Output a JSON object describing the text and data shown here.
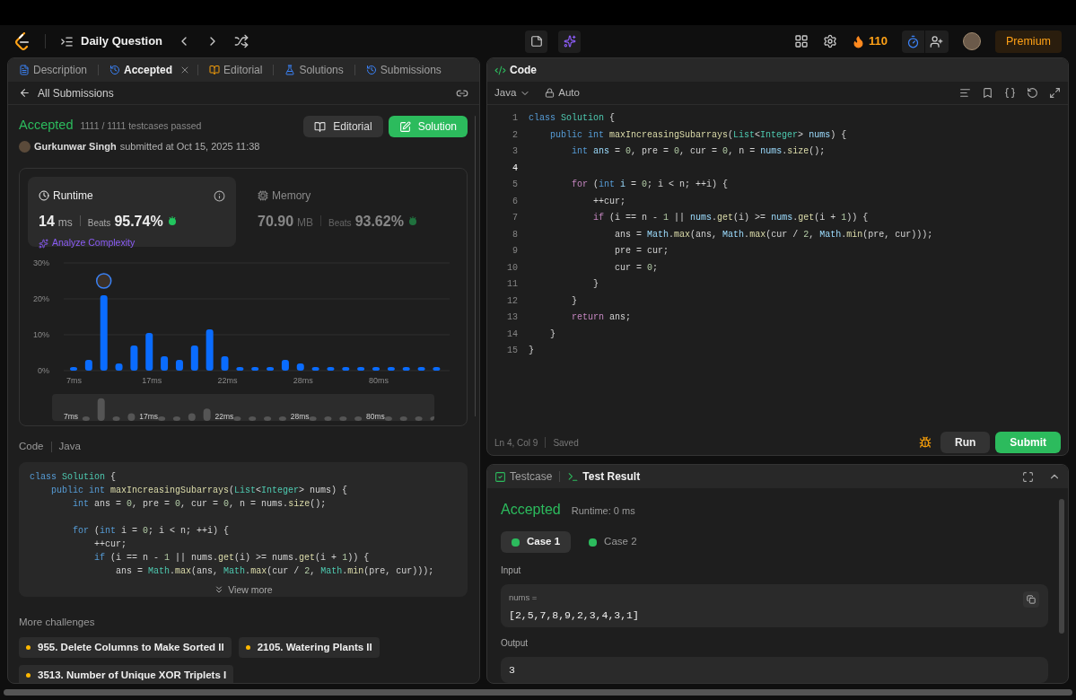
{
  "topbar": {
    "title": "Daily Question",
    "streak": "110",
    "premium": "Premium"
  },
  "left_panel": {
    "tabs": [
      {
        "label": "Description",
        "selected": false,
        "kind": "description"
      },
      {
        "label": "Accepted",
        "selected": true,
        "kind": "accepted",
        "closable": true
      },
      {
        "label": "Editorial",
        "selected": false,
        "kind": "editorial"
      },
      {
        "label": "Solutions",
        "selected": false,
        "kind": "solutions"
      },
      {
        "label": "Submissions",
        "selected": false,
        "kind": "submissions"
      }
    ],
    "back_link": "All Submissions",
    "status": "Accepted",
    "testcases": "1111 / 1111 testcases passed",
    "author": "Gurkunwar Singh",
    "submitted": "submitted at Oct 15, 2025 11:38",
    "buttons": [
      {
        "label": "Editorial",
        "kind": "secondary"
      },
      {
        "label": "Solution",
        "kind": "primary"
      }
    ],
    "runtime": {
      "label": "Runtime",
      "value": "14",
      "unit": "ms",
      "beats_label": "Beats",
      "beats": "95.74%",
      "analyze": "Analyze Complexity",
      "selected": true
    },
    "memory": {
      "label": "Memory",
      "value": "70.90",
      "unit": "MB",
      "beats_label": "Beats",
      "beats": "93.62%",
      "selected": false
    },
    "chart_data": {
      "type": "bar",
      "categories": [
        "7ms",
        null,
        null,
        null,
        null,
        "17ms",
        null,
        null,
        null,
        null,
        "22ms",
        null,
        null,
        null,
        null,
        "28ms",
        null,
        null,
        null,
        null,
        "80ms",
        null,
        null,
        null,
        null
      ],
      "values": [
        1,
        3,
        21,
        2,
        7,
        10.5,
        4,
        3,
        7,
        11.5,
        4,
        1,
        1,
        1,
        3,
        2,
        1,
        1,
        1,
        1,
        1,
        1,
        1,
        1,
        1
      ],
      "ylim": [
        0,
        30
      ],
      "yticks": [
        {
          "value": 0,
          "label": "0%"
        },
        {
          "value": 10,
          "label": "10%"
        },
        {
          "value": 20,
          "label": "20%"
        },
        {
          "value": 30,
          "label": "30%"
        }
      ]
    },
    "overview_labels": [
      "7ms",
      "17ms",
      "22ms",
      "28ms",
      "80ms"
    ],
    "code_label": "Code",
    "code_lang": "Java",
    "code_lines": [
      {
        "kind": "code",
        "tokens": [
          {
            "kind": "keyword",
            "text": "class "
          },
          {
            "kind": "type",
            "text": "Solution"
          },
          {
            "kind": "plain",
            "text": " {"
          }
        ]
      },
      {
        "kind": "code",
        "tokens": [
          {
            "kind": "keyword",
            "text": "    public int "
          },
          {
            "kind": "function",
            "text": "maxIncreasingSubarrays"
          },
          {
            "kind": "plain",
            "text": "("
          },
          {
            "kind": "type",
            "text": "List"
          },
          {
            "kind": "plain",
            "text": "<"
          },
          {
            "kind": "type",
            "text": "Integer"
          },
          {
            "kind": "plain",
            "text": "> nums) {"
          }
        ]
      },
      {
        "kind": "code",
        "tokens": [
          {
            "kind": "keyword",
            "text": "        int"
          },
          {
            "kind": "plain",
            "text": " ans = "
          },
          {
            "kind": "number",
            "text": "0"
          },
          {
            "kind": "plain",
            "text": ", pre = "
          },
          {
            "kind": "number",
            "text": "0"
          },
          {
            "kind": "plain",
            "text": ", cur = "
          },
          {
            "kind": "number",
            "text": "0"
          },
          {
            "kind": "plain",
            "text": ", n = nums."
          },
          {
            "kind": "function",
            "text": "size"
          },
          {
            "kind": "plain",
            "text": "();"
          }
        ]
      },
      {
        "kind": "blank"
      },
      {
        "kind": "code",
        "tokens": [
          {
            "kind": "keyword",
            "text": "        for"
          },
          {
            "kind": "plain",
            "text": " ("
          },
          {
            "kind": "keyword",
            "text": "int"
          },
          {
            "kind": "plain",
            "text": " i = "
          },
          {
            "kind": "number",
            "text": "0"
          },
          {
            "kind": "plain",
            "text": "; i < n; ++i) {"
          }
        ]
      },
      {
        "kind": "code",
        "tokens": [
          {
            "kind": "plain",
            "text": "            ++cur;"
          }
        ]
      },
      {
        "kind": "code",
        "tokens": [
          {
            "kind": "keyword",
            "text": "            if"
          },
          {
            "kind": "plain",
            "text": " (i == n - "
          },
          {
            "kind": "number",
            "text": "1"
          },
          {
            "kind": "plain",
            "text": " || nums."
          },
          {
            "kind": "function",
            "text": "get"
          },
          {
            "kind": "plain",
            "text": "(i) >= nums."
          },
          {
            "kind": "function",
            "text": "get"
          },
          {
            "kind": "plain",
            "text": "(i + "
          },
          {
            "kind": "number",
            "text": "1"
          },
          {
            "kind": "plain",
            "text": ")) {"
          }
        ]
      },
      {
        "kind": "code",
        "tokens": [
          {
            "kind": "plain",
            "text": "                ans = "
          },
          {
            "kind": "type",
            "text": "Math"
          },
          {
            "kind": "plain",
            "text": "."
          },
          {
            "kind": "function",
            "text": "max"
          },
          {
            "kind": "plain",
            "text": "(ans, "
          },
          {
            "kind": "type",
            "text": "Math"
          },
          {
            "kind": "plain",
            "text": "."
          },
          {
            "kind": "function",
            "text": "max"
          },
          {
            "kind": "plain",
            "text": "(cur / "
          },
          {
            "kind": "number",
            "text": "2"
          },
          {
            "kind": "plain",
            "text": ", "
          },
          {
            "kind": "type",
            "text": "Math"
          },
          {
            "kind": "plain",
            "text": "."
          },
          {
            "kind": "function",
            "text": "min"
          },
          {
            "kind": "plain",
            "text": "(pre, cur)));"
          }
        ]
      }
    ],
    "view_more": "View more",
    "more_title": "More challenges",
    "challenges": [
      {
        "label": "955. Delete Columns to Make Sorted II",
        "color": "#ffb800"
      },
      {
        "label": "2105. Watering Plants II",
        "color": "#ffb800"
      },
      {
        "label": "3513. Number of Unique XOR Triplets I",
        "color": "#ffb800"
      }
    ]
  },
  "editor": {
    "tab": "Code",
    "language": "Java",
    "mode": "Auto",
    "lines": [
      {
        "number": "1",
        "selected": false,
        "tokens": [
          {
            "kind": "keyword",
            "text": "class "
          },
          {
            "kind": "type",
            "text": "Solution"
          },
          {
            "kind": "plain",
            "text": " {"
          }
        ]
      },
      {
        "number": "2",
        "selected": false,
        "tokens": [
          {
            "kind": "keyword",
            "text": "    public int "
          },
          {
            "kind": "function",
            "text": "maxIncreasingSubarrays"
          },
          {
            "kind": "plain",
            "text": "("
          },
          {
            "kind": "type",
            "text": "List"
          },
          {
            "kind": "plain",
            "text": "<"
          },
          {
            "kind": "type",
            "text": "Integer"
          },
          {
            "kind": "plain",
            "text": "> "
          },
          {
            "kind": "variable",
            "text": "nums"
          },
          {
            "kind": "plain",
            "text": ") {"
          }
        ]
      },
      {
        "number": "3",
        "selected": false,
        "tokens": [
          {
            "kind": "keyword",
            "text": "        int "
          },
          {
            "kind": "variable",
            "text": "ans"
          },
          {
            "kind": "plain",
            "text": " = "
          },
          {
            "kind": "number",
            "text": "0"
          },
          {
            "kind": "plain",
            "text": ", pre = "
          },
          {
            "kind": "number",
            "text": "0"
          },
          {
            "kind": "plain",
            "text": ", cur = "
          },
          {
            "kind": "number",
            "text": "0"
          },
          {
            "kind": "plain",
            "text": ", n = "
          },
          {
            "kind": "variable",
            "text": "nums"
          },
          {
            "kind": "plain",
            "text": "."
          },
          {
            "kind": "function",
            "text": "size"
          },
          {
            "kind": "plain",
            "text": "();"
          }
        ]
      },
      {
        "number": "4",
        "selected": true
      },
      {
        "number": "5",
        "selected": false,
        "tokens": [
          {
            "kind": "control",
            "text": "        for"
          },
          {
            "kind": "plain",
            "text": " ("
          },
          {
            "kind": "keyword",
            "text": "int "
          },
          {
            "kind": "variable",
            "text": "i"
          },
          {
            "kind": "plain",
            "text": " = "
          },
          {
            "kind": "number",
            "text": "0"
          },
          {
            "kind": "plain",
            "text": "; i < n; ++i) {"
          }
        ]
      },
      {
        "number": "6",
        "selected": false,
        "tokens": [
          {
            "kind": "plain",
            "text": "            ++cur;"
          }
        ]
      },
      {
        "number": "7",
        "selected": false,
        "tokens": [
          {
            "kind": "control",
            "text": "            if"
          },
          {
            "kind": "plain",
            "text": " (i == n - "
          },
          {
            "kind": "number",
            "text": "1"
          },
          {
            "kind": "plain",
            "text": " || "
          },
          {
            "kind": "variable",
            "text": "nums"
          },
          {
            "kind": "plain",
            "text": "."
          },
          {
            "kind": "function",
            "text": "get"
          },
          {
            "kind": "plain",
            "text": "(i) >= "
          },
          {
            "kind": "variable",
            "text": "nums"
          },
          {
            "kind": "plain",
            "text": "."
          },
          {
            "kind": "function",
            "text": "get"
          },
          {
            "kind": "plain",
            "text": "(i + "
          },
          {
            "kind": "number",
            "text": "1"
          },
          {
            "kind": "plain",
            "text": ")) {"
          }
        ]
      },
      {
        "number": "8",
        "selected": false,
        "tokens": [
          {
            "kind": "plain",
            "text": "                ans = "
          },
          {
            "kind": "variable",
            "text": "Math"
          },
          {
            "kind": "plain",
            "text": "."
          },
          {
            "kind": "function",
            "text": "max"
          },
          {
            "kind": "plain",
            "text": "(ans, "
          },
          {
            "kind": "variable",
            "text": "Math"
          },
          {
            "kind": "plain",
            "text": "."
          },
          {
            "kind": "function",
            "text": "max"
          },
          {
            "kind": "plain",
            "text": "(cur / "
          },
          {
            "kind": "number",
            "text": "2"
          },
          {
            "kind": "plain",
            "text": ", "
          },
          {
            "kind": "variable",
            "text": "Math"
          },
          {
            "kind": "plain",
            "text": "."
          },
          {
            "kind": "function",
            "text": "min"
          },
          {
            "kind": "plain",
            "text": "(pre, cur)));"
          }
        ]
      },
      {
        "number": "9",
        "selected": false,
        "tokens": [
          {
            "kind": "plain",
            "text": "                pre = cur;"
          }
        ]
      },
      {
        "number": "10",
        "selected": false,
        "tokens": [
          {
            "kind": "plain",
            "text": "                cur = "
          },
          {
            "kind": "number",
            "text": "0"
          },
          {
            "kind": "plain",
            "text": ";"
          }
        ]
      },
      {
        "number": "11",
        "selected": false,
        "tokens": [
          {
            "kind": "plain",
            "text": "            }"
          }
        ]
      },
      {
        "number": "12",
        "selected": false,
        "tokens": [
          {
            "kind": "plain",
            "text": "        }"
          }
        ]
      },
      {
        "number": "13",
        "selected": false,
        "tokens": [
          {
            "kind": "control",
            "text": "        return"
          },
          {
            "kind": "plain",
            "text": " ans;"
          }
        ]
      },
      {
        "number": "14",
        "selected": false,
        "tokens": [
          {
            "kind": "plain",
            "text": "    }"
          }
        ]
      },
      {
        "number": "15",
        "selected": false,
        "tokens": [
          {
            "kind": "plain",
            "text": "}"
          }
        ]
      }
    ],
    "cursor": "Ln 4, Col 9",
    "saved": "Saved",
    "run": "Run",
    "submit": "Submit"
  },
  "result_panel": {
    "tabs": [
      {
        "label": "Testcase",
        "selected": false,
        "kind": "testcase"
      },
      {
        "label": "Test Result",
        "selected": true,
        "kind": "result"
      }
    ],
    "status": "Accepted",
    "runtime": "Runtime: 0 ms",
    "cases": [
      {
        "label": "Case 1",
        "selected": true
      },
      {
        "label": "Case 2",
        "selected": false
      }
    ],
    "input_label": "Input",
    "input_name": "nums =",
    "input_value": "[2,5,7,8,9,2,3,4,3,1]",
    "output_label": "Output",
    "output_value": "3"
  }
}
